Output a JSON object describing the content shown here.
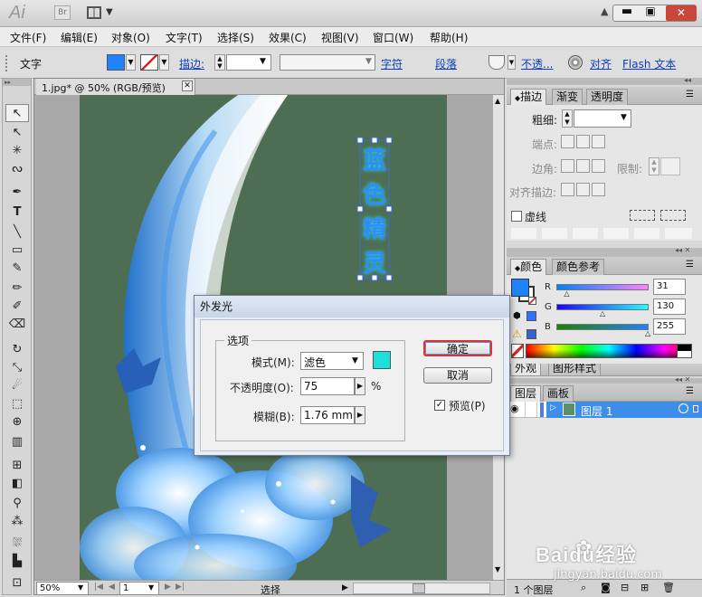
{
  "app": {
    "logo": "Ai",
    "bridge": "Br"
  },
  "menu": [
    "文件(F)",
    "编辑(E)",
    "对象(O)",
    "文字(T)",
    "选择(S)",
    "效果(C)",
    "视图(V)",
    "窗口(W)",
    "帮助(H)"
  ],
  "control_bar": {
    "tool_label": "文字",
    "stroke_label": "描边:",
    "char_link": "字符",
    "para_link": "段落",
    "opacity_link": "不透...",
    "align_link": "对齐",
    "flash_text": "Flash 文本"
  },
  "document": {
    "tab_title": "1.jpg* @ 50% (RGB/预览)",
    "art_text": [
      "蓝",
      "色",
      "精",
      "灵"
    ]
  },
  "status": {
    "zoom": "50%",
    "page": "1",
    "mode": "选择"
  },
  "stroke_panel": {
    "tabs": [
      "描边",
      "渐变",
      "透明度"
    ],
    "weight_label": "粗细:",
    "cap_label": "端点:",
    "corner_label": "边角:",
    "limit_label": "限制:",
    "align_label": "对齐描边:",
    "dashed_label": "虚线"
  },
  "color_panel": {
    "tabs": [
      "颜色",
      "颜色参考"
    ],
    "r_label": "R",
    "g_label": "G",
    "b_label": "B",
    "r_value": "31",
    "g_value": "130",
    "b_value": "255",
    "r": 31,
    "g": 130,
    "b": 255,
    "fill_color": "#1f82ff"
  },
  "appearance_tabs": [
    "外观",
    "图形样式"
  ],
  "layers_panel": {
    "tabs": [
      "图层",
      "画板"
    ],
    "layer_name": "图层 1",
    "footer": "1 个图层"
  },
  "dialog": {
    "title": "外发光",
    "group_label": "选项",
    "mode_label": "模式(M):",
    "mode_value": "滤色",
    "glow_color": "#1de0dc",
    "opacity_label": "不透明度(O):",
    "opacity_value": "75",
    "opacity_unit": "%",
    "blur_label": "模糊(B):",
    "blur_value": "1.76 mm",
    "ok_label": "确定",
    "cancel_label": "取消",
    "preview_label": "预览(P)"
  },
  "watermark": {
    "brand": "Baidu经验",
    "url": "jingyan.baidu.com"
  }
}
